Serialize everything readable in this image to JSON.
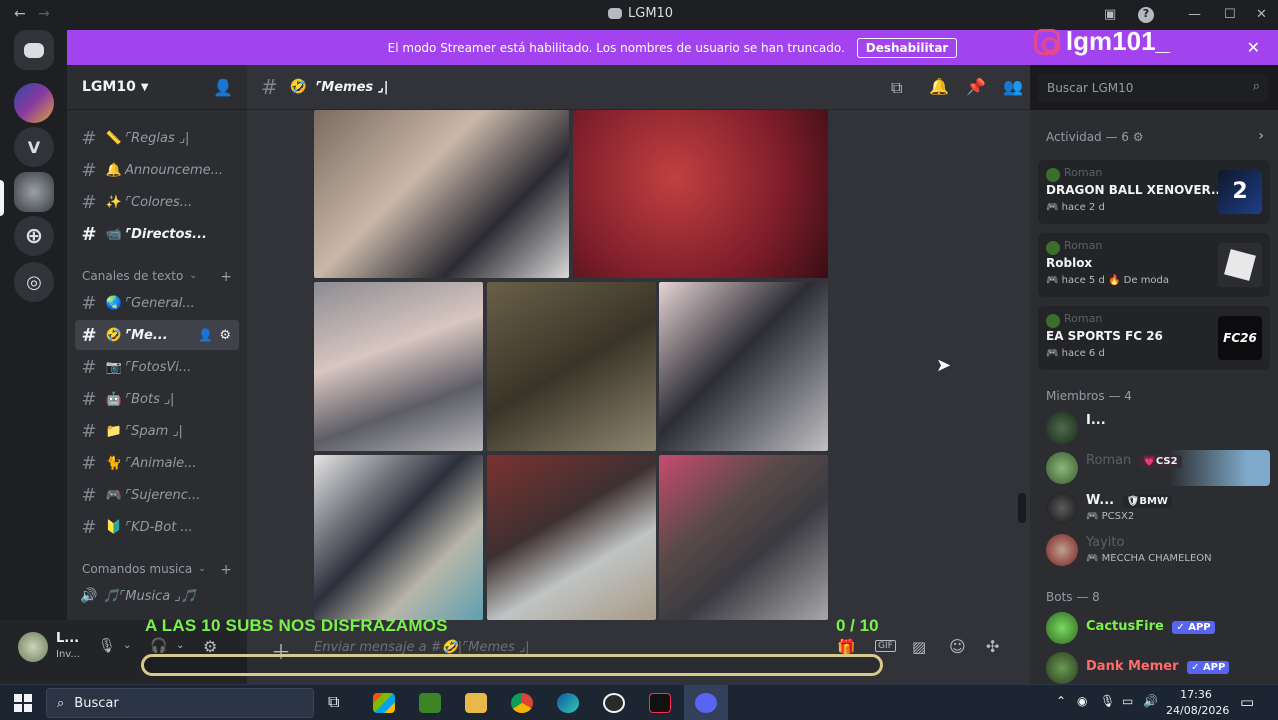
{
  "window": {
    "title": "LGM10"
  },
  "banner": {
    "text": "El modo Streamer está habilitado. Los nombres de usuario se han truncado.",
    "button": "Deshabilitar"
  },
  "watermark": {
    "handle": "lgm101_"
  },
  "rail": {
    "server_letter": "V"
  },
  "server": {
    "name": "LGM10"
  },
  "channels_top": [
    {
      "emoji": "📏",
      "label": "⌜Reglas ⌟|"
    },
    {
      "emoji": "🔔",
      "label": "Announceme..."
    },
    {
      "emoji": "✨",
      "label": "⌜Colores..."
    },
    {
      "emoji": "📹",
      "label": "⌜Directos..."
    }
  ],
  "categories": {
    "text": "Canales de texto",
    "music": "Comandos musica"
  },
  "channels_text": [
    {
      "emoji": "🌏",
      "label": "⌜General..."
    },
    {
      "emoji": "🤣",
      "label": "⌜Me..."
    },
    {
      "emoji": "📷",
      "label": "⌜FotosVi..."
    },
    {
      "emoji": "🤖",
      "label": "⌜Bots ⌟|"
    },
    {
      "emoji": "📁",
      "label": "⌜Spam ⌟|"
    },
    {
      "emoji": "🐈",
      "label": "⌜Animale..."
    },
    {
      "emoji": "🎮",
      "label": "⌜Sujerenc..."
    },
    {
      "emoji": "🔰",
      "label": "⌜KD-Bot ..."
    }
  ],
  "channel_music": {
    "label": "🎵⌜Musica ⌟🎵"
  },
  "user": {
    "name": "L...",
    "status": "Inv..."
  },
  "chat": {
    "channel_title": "⌜Memes ⌟|",
    "composer_placeholder": "Enviar mensaje a #🤣|⌜Memes ⌟|"
  },
  "search": {
    "placeholder": "Buscar LGM10"
  },
  "activity": {
    "header": "Actividad — 6",
    "cards": [
      {
        "who": "Roman",
        "game": "DRAGON BALL XENOVER...",
        "meta": "hace 2 d",
        "extra": ""
      },
      {
        "who": "Roman",
        "game": "Roblox",
        "meta": "hace 5 d",
        "extra": "De moda"
      },
      {
        "who": "Roman",
        "game": "EA SPORTS FC 26",
        "meta": "hace 6 d",
        "extra": ""
      }
    ]
  },
  "members": {
    "header": "Miembros — 4",
    "list": [
      {
        "name": "I...",
        "tag": "",
        "sub": ""
      },
      {
        "name": "Roman",
        "tag": "CS2",
        "sub": ""
      },
      {
        "name": "W...",
        "tag": "BMW",
        "sub": "PCSX2"
      },
      {
        "name": "Yayito",
        "tag": "",
        "sub": "MECCHA CHAMELEON"
      }
    ]
  },
  "bots": {
    "header": "Bots — 8",
    "list": [
      {
        "name": "CactusFire",
        "tag": "APP"
      },
      {
        "name": "Dank Memer",
        "tag": "APP"
      }
    ]
  },
  "overlay": {
    "text": "A LAS 10 SUBS NOS DISFRAZAMOS",
    "count": "0 / 10"
  },
  "taskbar": {
    "search": "Buscar",
    "time": "17:36",
    "date": "24/08/2026"
  },
  "colors": {
    "streamer_banner": "#a343f0",
    "overlay_text": "#7bf24a",
    "app_tag": "#5865f2",
    "bot_cactus": "#7bf24a",
    "bot_dank": "#ff6b6b"
  }
}
